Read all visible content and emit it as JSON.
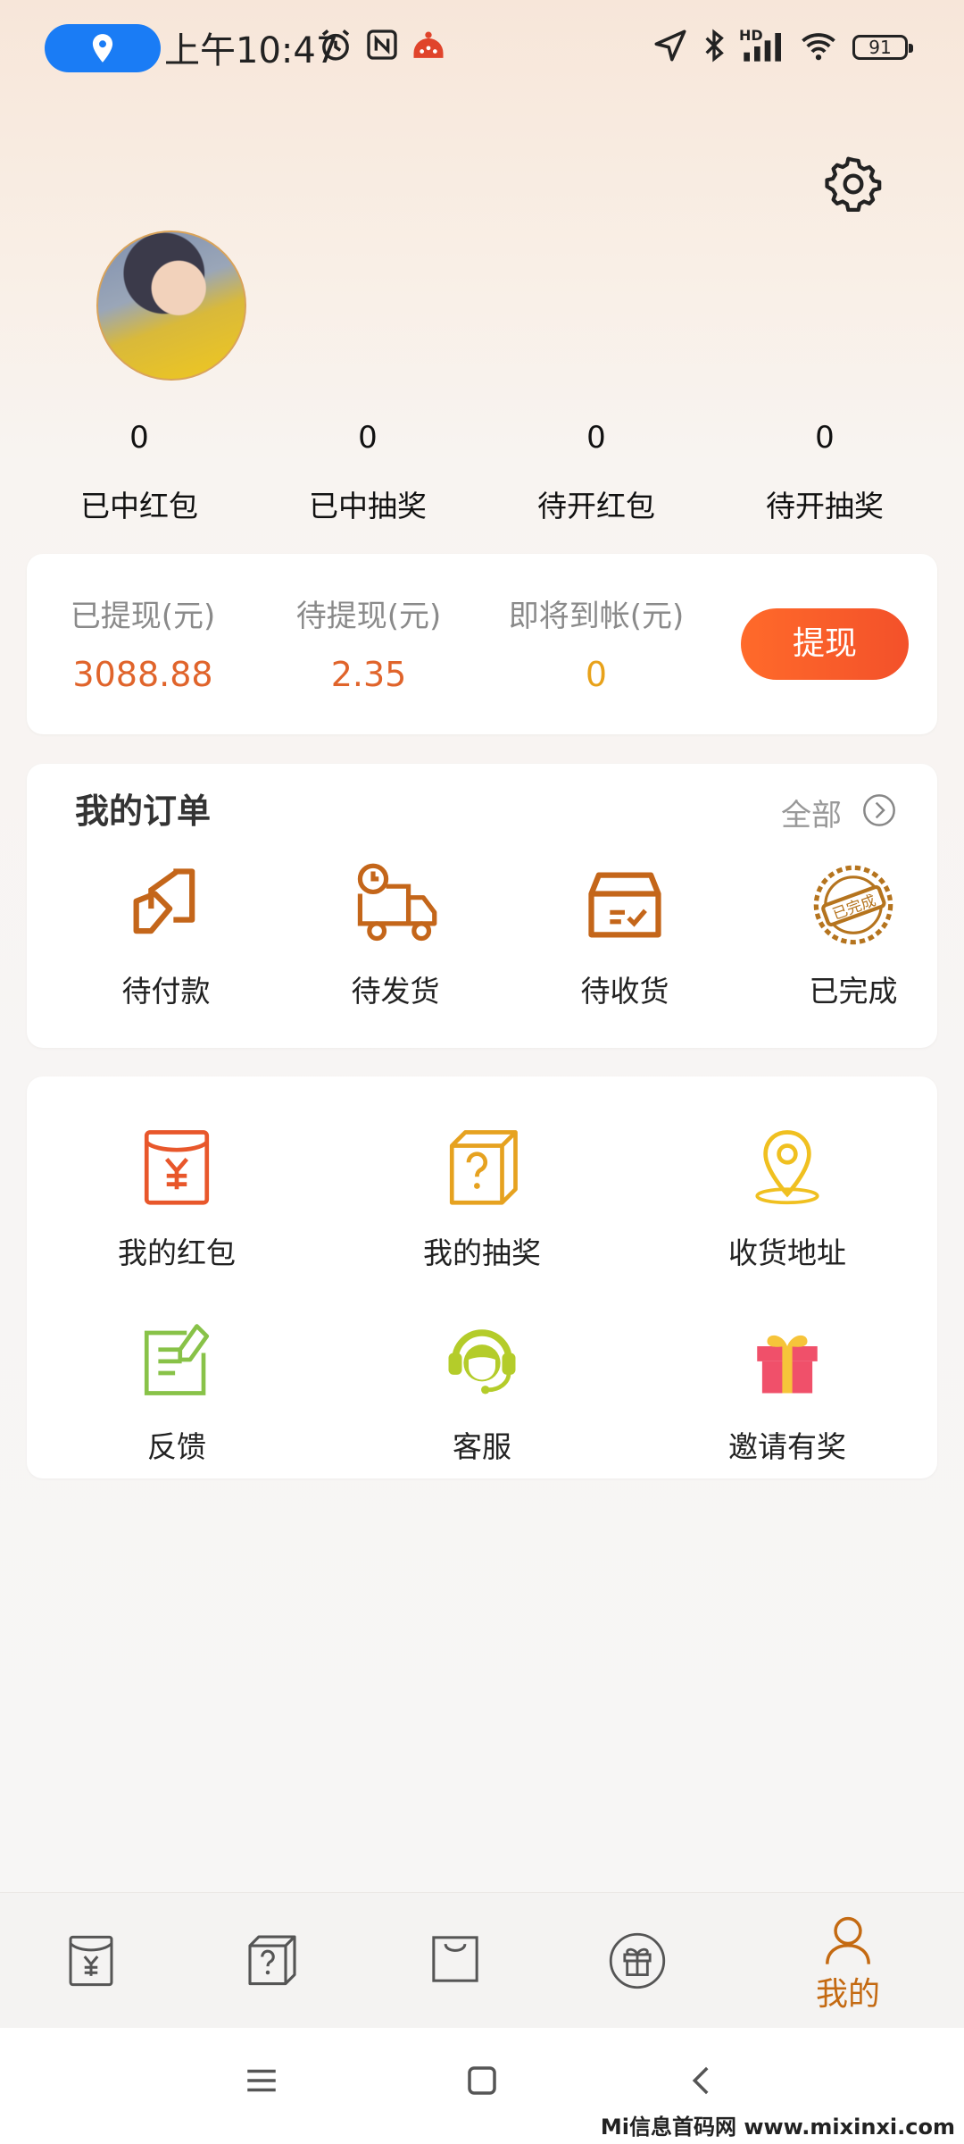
{
  "status_bar": {
    "time": "上午10:47",
    "battery": "91",
    "network": "HD"
  },
  "profile": {
    "settings_icon": "gear-icon",
    "avatar": "user-avatar"
  },
  "stats": [
    {
      "value": "0",
      "label": "已中红包"
    },
    {
      "value": "0",
      "label": "已中抽奖"
    },
    {
      "value": "0",
      "label": "待开红包"
    },
    {
      "value": "0",
      "label": "待开抽奖"
    }
  ],
  "wallet": {
    "withdrawn_label": "已提现(元)",
    "withdrawn_value": "3088.88",
    "pending_label": "待提现(元)",
    "pending_value": "2.35",
    "incoming_label": "即将到帐(元)",
    "incoming_value": "0",
    "withdraw_button": "提现",
    "colors": {
      "amount": "#e0642b",
      "incoming": "#e8a21a",
      "button": "#f3512a"
    }
  },
  "orders": {
    "title": "我的订单",
    "all_label": "全部",
    "items": [
      {
        "label": "待付款",
        "icon": "payment-icon"
      },
      {
        "label": "待发货",
        "icon": "delivery-truck-icon"
      },
      {
        "label": "待收货",
        "icon": "package-box-icon"
      },
      {
        "label": "已完成",
        "icon": "completed-stamp-icon"
      }
    ],
    "stamp_text": "已完成"
  },
  "services": [
    {
      "label": "我的红包",
      "icon": "red-envelope-icon"
    },
    {
      "label": "我的抽奖",
      "icon": "mystery-box-icon"
    },
    {
      "label": "收货地址",
      "icon": "location-pin-icon"
    },
    {
      "label": "反馈",
      "icon": "feedback-icon"
    },
    {
      "label": "客服",
      "icon": "customer-service-icon"
    },
    {
      "label": "邀请有奖",
      "icon": "gift-icon"
    }
  ],
  "tabbar": {
    "items": [
      {
        "icon": "red-envelope-icon"
      },
      {
        "icon": "mystery-box-icon"
      },
      {
        "icon": "shopping-bag-icon"
      },
      {
        "icon": "gift-icon"
      },
      {
        "icon": "user-icon",
        "label": "我的",
        "active": true
      }
    ]
  },
  "watermark": "Mi信息首码网 www.mixinxi.com"
}
